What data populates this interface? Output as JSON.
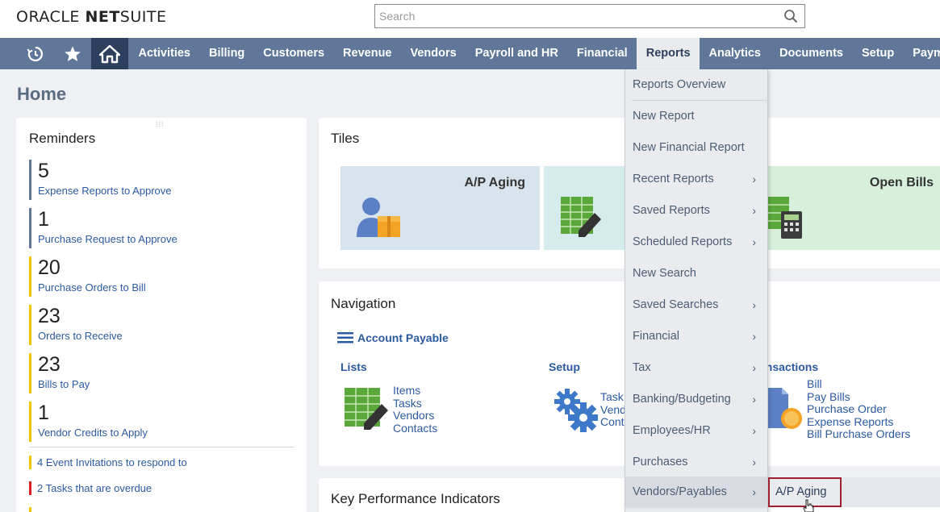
{
  "brand": {
    "part1": "ORACLE ",
    "part2": "NET",
    "part3": "SUITE"
  },
  "search": {
    "placeholder": "Search"
  },
  "nav": {
    "icons": [
      "recent-records-icon",
      "star-icon",
      "home-icon"
    ],
    "items": [
      "Activities",
      "Billing",
      "Customers",
      "Revenue",
      "Vendors",
      "Payroll and HR",
      "Financial",
      "Reports",
      "Analytics",
      "Documents",
      "Setup",
      "Paymen"
    ],
    "active": "Reports"
  },
  "page": {
    "title": "Home"
  },
  "reminders": {
    "title": "Reminders",
    "items": [
      {
        "count": "5",
        "label": "Expense Reports to Approve",
        "color": "#607799"
      },
      {
        "count": "1",
        "label": "Purchase Request to Approve",
        "color": "#607799"
      },
      {
        "count": "20",
        "label": "Purchase Orders to Bill",
        "color": "#f2c500"
      },
      {
        "count": "23",
        "label": "Orders to Receive",
        "color": "#f2c500"
      },
      {
        "count": "23",
        "label": "Bills to Pay",
        "color": "#f2c500"
      },
      {
        "count": "1",
        "label": "Vendor Credits to Apply",
        "color": "#f2c500"
      }
    ],
    "small": [
      {
        "count": "4",
        "label": "Event Invitations to respond to",
        "color": "#f2c500"
      },
      {
        "count": "2",
        "label": "Tasks that are overdue",
        "color": "#e02020"
      }
    ]
  },
  "tiles": {
    "title": "Tiles",
    "items": [
      {
        "label": "A/P Aging",
        "bg": "#d7e4ee"
      },
      {
        "label": "",
        "bg": "#d6ecec"
      },
      {
        "label": "Open Bills",
        "bg": "#d8efdc"
      }
    ]
  },
  "navigation": {
    "title": "Navigation",
    "center_link": "Account Payable",
    "lists": {
      "title": "Lists",
      "links": [
        "Items",
        "Tasks",
        "Vendors",
        "Contacts"
      ]
    },
    "setup": {
      "title": "Setup",
      "links": [
        "Task",
        "Vend",
        "Conta"
      ]
    },
    "transactions": {
      "title": "ansactions",
      "links": [
        "Bill",
        "Pay Bills",
        "Purchase Order",
        "Expense Reports",
        "Bill Purchase Orders"
      ]
    }
  },
  "kpi": {
    "title": "Key Performance Indicators"
  },
  "reports_menu": {
    "items": [
      {
        "label": "Reports Overview",
        "has_sub": false
      },
      {
        "label": "New Report",
        "has_sub": false
      },
      {
        "label": "New Financial Report",
        "has_sub": false
      },
      {
        "label": "Recent Reports",
        "has_sub": true
      },
      {
        "label": "Saved Reports",
        "has_sub": true
      },
      {
        "label": "Scheduled Reports",
        "has_sub": true
      },
      {
        "label": "New Search",
        "has_sub": false
      },
      {
        "label": "Saved Searches",
        "has_sub": true
      },
      {
        "label": "Financial",
        "has_sub": true
      },
      {
        "label": "Tax",
        "has_sub": true
      },
      {
        "label": "Banking/Budgeting",
        "has_sub": true
      },
      {
        "label": "Employees/HR",
        "has_sub": true
      },
      {
        "label": "Purchases",
        "has_sub": true
      },
      {
        "label": "Vendors/Payables",
        "has_sub": true
      }
    ],
    "highlighted": "Vendors/Payables",
    "submenu": {
      "items": [
        "A/P Aging"
      ]
    }
  }
}
